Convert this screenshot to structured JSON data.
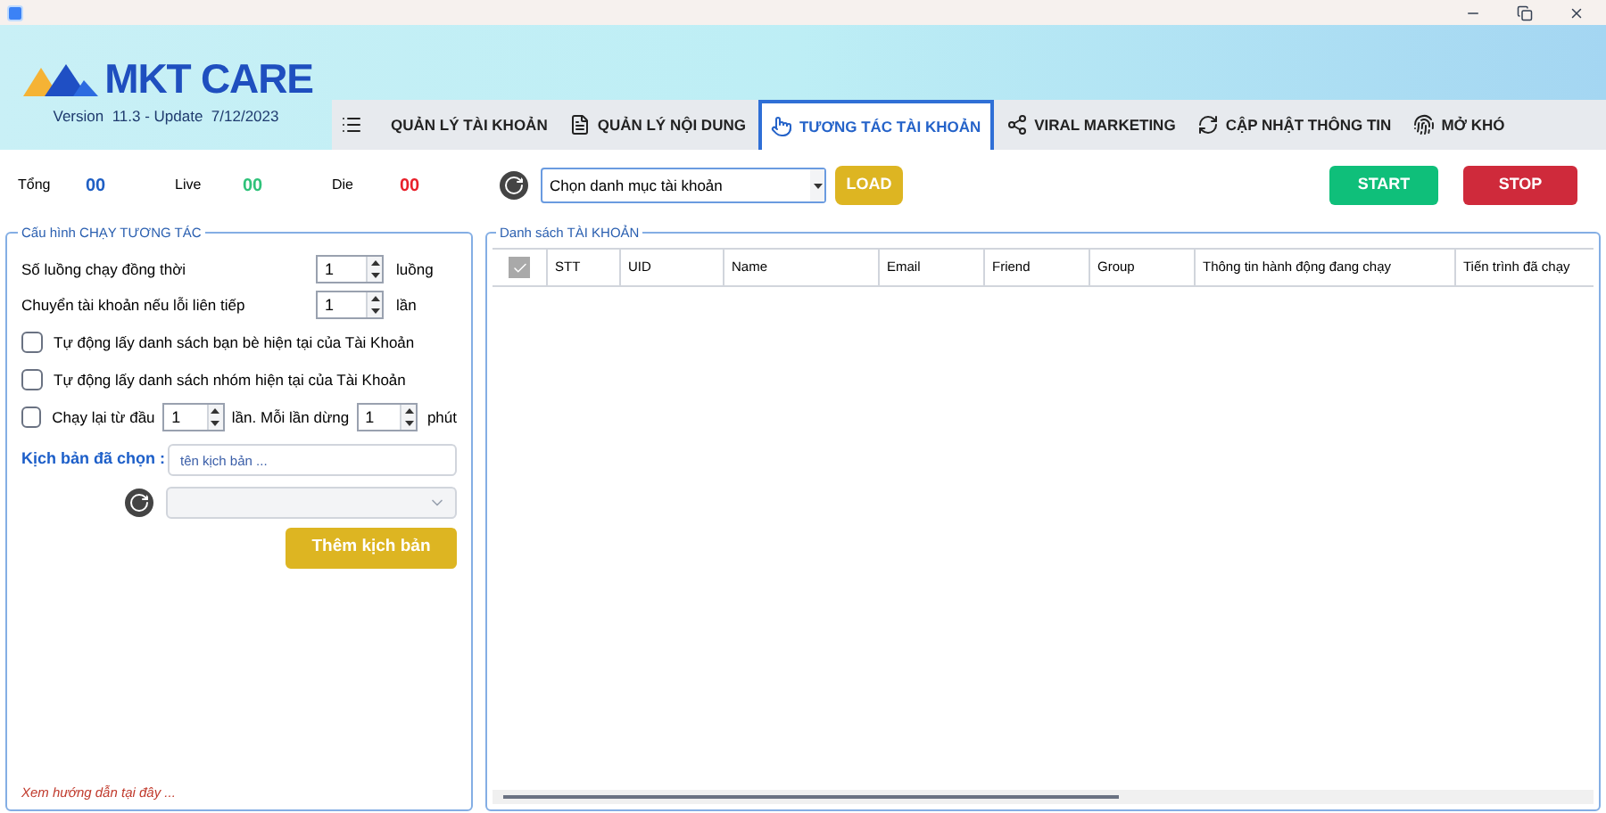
{
  "brand": {
    "name": "MKT CARE",
    "version": "Version  11.3 - Update  7/12/2023"
  },
  "tabs": [
    {
      "label": "QUẢN LÝ TÀI KHOẢN",
      "selected": false
    },
    {
      "label": "QUẢN LÝ NỘI DUNG",
      "selected": false
    },
    {
      "label": "TƯƠNG TÁC TÀI KHOẢN",
      "selected": true
    },
    {
      "label": "VIRAL MARKETING",
      "selected": false
    },
    {
      "label": "CẬP NHẬT THÔNG TIN",
      "selected": false
    },
    {
      "label": "MỞ KHÓ",
      "selected": false
    }
  ],
  "stats": [
    {
      "label": "Tổng",
      "value": "00",
      "color": "#1f5fc4"
    },
    {
      "label": "Live",
      "value": "00",
      "color": "#2fc27a"
    },
    {
      "label": "Die",
      "value": "00",
      "color": "#e8202a"
    }
  ],
  "category_select": {
    "value": "Chọn danh mục tài khoản"
  },
  "load_button": "LOAD",
  "start_button": "START",
  "stop_button": "STOP",
  "config": {
    "title": "Cấu hình CHẠY TƯƠNG TÁC",
    "spinners": [
      {
        "label": "Số luồng chạy đồng thời",
        "value": "1",
        "unit": "luồng"
      },
      {
        "label": "Chuyển tài khoản nếu lỗi liên tiếp",
        "value": "1",
        "unit": "lần"
      }
    ],
    "options": [
      {
        "label": "Tự động lấy danh sách bạn bè hiện tại của Tài Khoản",
        "checked": false
      },
      {
        "label": "Tự động lấy danh sách nhóm hiện tại của Tài Khoản",
        "checked": false
      }
    ],
    "rerun": {
      "label": "Chạy lại từ đầu",
      "checked": false,
      "times": "1",
      "middle": "lần. Mỗi lần dừng",
      "minutes": "1",
      "unit": "phút"
    },
    "script_label": "Kịch bản đã chọn :",
    "script_placeholder": "tên kịch bản ...",
    "add_button": "Thêm kịch bản",
    "help_link": "Xem hướng dẫn tại đây ..."
  },
  "accounts": {
    "title": "Danh sách TÀI KHOẢN",
    "select_all_checked": true,
    "columns": [
      "STT",
      "UID",
      "Name",
      "Email",
      "Friend",
      "Group",
      "Thông tin hành động đang chạy",
      "Tiến trình đã chạy"
    ]
  }
}
